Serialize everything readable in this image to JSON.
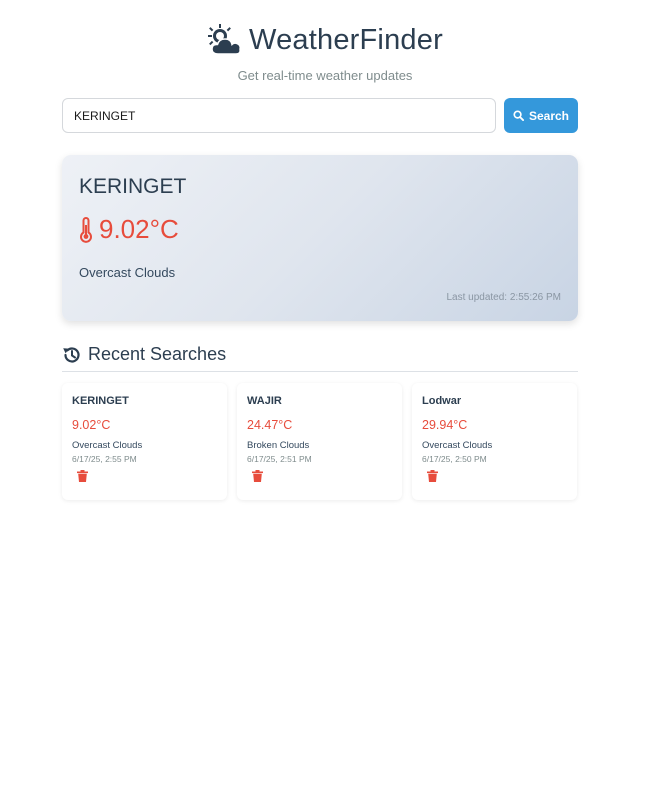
{
  "header": {
    "title": "WeatherFinder",
    "subtitle": "Get real-time weather updates",
    "logo_icon": "cloud-sun-icon"
  },
  "search": {
    "value": "KERINGET",
    "button_label": "Search",
    "button_icon": "search-icon",
    "button_color": "#3498db"
  },
  "current": {
    "city": "KERINGET",
    "temperature": "9.02°C",
    "temperature_icon": "thermometer-icon",
    "condition": "Overcast Clouds",
    "last_updated": "Last updated: 2:55:26 PM",
    "temperature_color": "#e74c3c"
  },
  "recent": {
    "title": "Recent Searches",
    "icon": "history-icon",
    "items": [
      {
        "city": "KERINGET",
        "temperature": "9.02°C",
        "condition": "Overcast Clouds",
        "time": "6/17/25, 2:55 PM",
        "delete_icon": "trash-icon"
      },
      {
        "city": "WAJIR",
        "temperature": "24.47°C",
        "condition": "Broken Clouds",
        "time": "6/17/25, 2:51 PM",
        "delete_icon": "trash-icon"
      },
      {
        "city": "Lodwar",
        "temperature": "29.94°C",
        "condition": "Overcast Clouds",
        "time": "6/17/25, 2:50 PM",
        "delete_icon": "trash-icon"
      }
    ]
  }
}
